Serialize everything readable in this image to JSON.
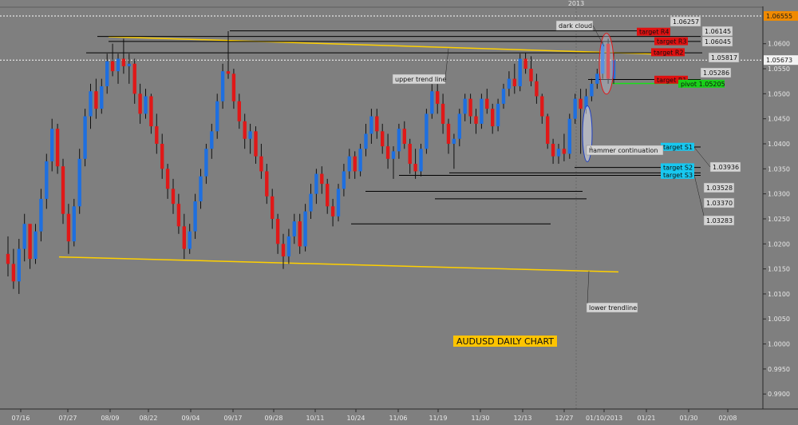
{
  "chart_data": {
    "type": "candlestick",
    "instrument": "AUDUSD",
    "title": "AUDUSD DAILY CHART",
    "period_marker": "2013",
    "x_tick_labels": [
      "07/16",
      "07/27",
      "08/09",
      "08/22",
      "09/04",
      "09/17",
      "09/28",
      "10/11",
      "10/24",
      "11/06",
      "11/19",
      "11/30",
      "12/13",
      "12/27",
      "01/10/2013",
      "01/21",
      "01/30",
      "02/08"
    ],
    "y_ticks": [
      "1.0600",
      "1.0550",
      "1.0500",
      "1.0450",
      "1.0400",
      "1.0350",
      "1.0300",
      "1.0250",
      "1.0200",
      "1.0150",
      "1.0100",
      "1.0050",
      "1.0000",
      "0.9950",
      "0.9900"
    ],
    "ylim": [
      0.987,
      1.0665
    ],
    "current_price": "1.05673",
    "high_price": "1.06555",
    "colors": {
      "up": "#1e6fe0",
      "down": "#e01818",
      "trend": "#ffd000",
      "bg": "#7f7f7f"
    },
    "candles": [
      [
        1.018,
        1.0215,
        1.0135,
        1.016
      ],
      [
        1.016,
        1.019,
        1.011,
        1.0125
      ],
      [
        1.0125,
        1.021,
        1.01,
        1.019
      ],
      [
        1.019,
        1.026,
        1.0165,
        1.024
      ],
      [
        1.024,
        1.0235,
        1.015,
        1.017
      ],
      [
        1.017,
        1.024,
        1.016,
        1.0225
      ],
      [
        1.0225,
        1.031,
        1.0205,
        1.029
      ],
      [
        1.029,
        1.038,
        1.027,
        1.0365
      ],
      [
        1.0365,
        1.045,
        1.0345,
        1.043
      ],
      [
        1.043,
        1.044,
        1.034,
        1.0355
      ],
      [
        1.0355,
        1.037,
        1.024,
        1.026
      ],
      [
        1.026,
        1.028,
        1.018,
        1.0205
      ],
      [
        1.0205,
        1.029,
        1.0195,
        1.0275
      ],
      [
        1.0275,
        1.039,
        1.026,
        1.037
      ],
      [
        1.037,
        1.047,
        1.0355,
        1.0455
      ],
      [
        1.0455,
        1.052,
        1.043,
        1.0505
      ],
      [
        1.0505,
        1.053,
        1.045,
        1.047
      ],
      [
        1.047,
        1.053,
        1.046,
        1.0515
      ],
      [
        1.0515,
        1.058,
        1.05,
        1.0565
      ],
      [
        1.0565,
        1.06,
        1.0535,
        1.0545
      ],
      [
        1.0545,
        1.058,
        1.052,
        1.057
      ],
      [
        1.057,
        1.061,
        1.054,
        1.0555
      ],
      [
        1.0555,
        1.058,
        1.052,
        1.056
      ],
      [
        1.056,
        1.057,
        1.048,
        1.05
      ],
      [
        1.05,
        1.052,
        1.044,
        1.046
      ],
      [
        1.046,
        1.051,
        1.045,
        1.0495
      ],
      [
        1.0495,
        1.05,
        1.042,
        1.0435
      ],
      [
        1.0435,
        1.046,
        1.038,
        1.04
      ],
      [
        1.04,
        1.042,
        1.033,
        1.035
      ],
      [
        1.035,
        1.036,
        1.029,
        1.031
      ],
      [
        1.031,
        1.033,
        1.026,
        1.028
      ],
      [
        1.028,
        1.03,
        1.022,
        1.0235
      ],
      [
        1.0235,
        1.026,
        1.017,
        1.019
      ],
      [
        1.019,
        1.024,
        1.018,
        1.0225
      ],
      [
        1.0225,
        1.03,
        1.021,
        1.0285
      ],
      [
        1.0285,
        1.035,
        1.027,
        1.0335
      ],
      [
        1.0335,
        1.04,
        1.032,
        1.039
      ],
      [
        1.039,
        1.044,
        1.037,
        1.0425
      ],
      [
        1.0425,
        1.05,
        1.041,
        1.0485
      ],
      [
        1.0485,
        1.056,
        1.047,
        1.0545
      ],
      [
        1.0545,
        1.0625,
        1.053,
        1.054
      ],
      [
        1.054,
        1.055,
        1.047,
        1.0485
      ],
      [
        1.0485,
        1.05,
        1.043,
        1.0445
      ],
      [
        1.0445,
        1.046,
        1.039,
        1.041
      ],
      [
        1.041,
        1.044,
        1.038,
        1.0425
      ],
      [
        1.0425,
        1.0435,
        1.036,
        1.0375
      ],
      [
        1.0375,
        1.04,
        1.033,
        1.0345
      ],
      [
        1.0345,
        1.036,
        1.028,
        1.0295
      ],
      [
        1.0295,
        1.031,
        1.023,
        1.025
      ],
      [
        1.025,
        1.026,
        1.018,
        1.02
      ],
      [
        1.02,
        1.022,
        1.015,
        1.0175
      ],
      [
        1.0175,
        1.023,
        1.016,
        1.0215
      ],
      [
        1.0215,
        1.026,
        1.02,
        1.0245
      ],
      [
        1.0245,
        1.026,
        1.018,
        1.0195
      ],
      [
        1.0195,
        1.028,
        1.0185,
        1.0265
      ],
      [
        1.0265,
        1.032,
        1.025,
        1.03
      ],
      [
        1.03,
        1.035,
        1.028,
        1.034
      ],
      [
        1.034,
        1.0355,
        1.03,
        1.032
      ],
      [
        1.032,
        1.033,
        1.026,
        1.0275
      ],
      [
        1.0275,
        1.029,
        1.0235,
        1.0255
      ],
      [
        1.0255,
        1.032,
        1.0245,
        1.031
      ],
      [
        1.031,
        1.036,
        1.0295,
        1.0345
      ],
      [
        1.0345,
        1.039,
        1.033,
        1.0375
      ],
      [
        1.0375,
        1.0385,
        1.033,
        1.0345
      ],
      [
        1.0345,
        1.04,
        1.0335,
        1.039
      ],
      [
        1.039,
        1.044,
        1.0375,
        1.042
      ],
      [
        1.042,
        1.047,
        1.04,
        1.0455
      ],
      [
        1.0455,
        1.047,
        1.041,
        1.0425
      ],
      [
        1.0425,
        1.044,
        1.038,
        1.0395
      ],
      [
        1.0395,
        1.042,
        1.035,
        1.037
      ],
      [
        1.037,
        1.0395,
        1.033,
        1.0385
      ],
      [
        1.0385,
        1.044,
        1.037,
        1.043
      ],
      [
        1.043,
        1.0445,
        1.039,
        1.04
      ],
      [
        1.04,
        1.041,
        1.034,
        1.036
      ],
      [
        1.036,
        1.039,
        1.033,
        1.0345
      ],
      [
        1.0345,
        1.04,
        1.0335,
        1.039
      ],
      [
        1.039,
        1.047,
        1.038,
        1.046
      ],
      [
        1.046,
        1.052,
        1.045,
        1.0505
      ],
      [
        1.0505,
        1.0525,
        1.046,
        1.048
      ],
      [
        1.048,
        1.05,
        1.042,
        1.044
      ],
      [
        1.044,
        1.045,
        1.038,
        1.04
      ],
      [
        1.04,
        1.042,
        1.035,
        1.041
      ],
      [
        1.041,
        1.047,
        1.0395,
        1.046
      ],
      [
        1.046,
        1.05,
        1.0445,
        1.049
      ],
      [
        1.049,
        1.05,
        1.044,
        1.0455
      ],
      [
        1.0455,
        1.047,
        1.042,
        1.044
      ],
      [
        1.044,
        1.05,
        1.043,
        1.049
      ],
      [
        1.049,
        1.051,
        1.046,
        1.047
      ],
      [
        1.047,
        1.048,
        1.042,
        1.0435
      ],
      [
        1.0435,
        1.049,
        1.0425,
        1.048
      ],
      [
        1.048,
        1.052,
        1.047,
        1.051
      ],
      [
        1.051,
        1.0545,
        1.0495,
        1.053
      ],
      [
        1.053,
        1.056,
        1.05,
        1.0515
      ],
      [
        1.0515,
        1.058,
        1.0505,
        1.057
      ],
      [
        1.057,
        1.0582,
        1.054,
        1.055
      ],
      [
        1.055,
        1.0575,
        1.0515,
        1.0525
      ],
      [
        1.0525,
        1.054,
        1.048,
        1.0495
      ],
      [
        1.0495,
        1.05,
        1.044,
        1.0455
      ],
      [
        1.0455,
        1.046,
        1.039,
        1.04
      ],
      [
        1.04,
        1.041,
        1.036,
        1.0375
      ],
      [
        1.0375,
        1.04,
        1.036,
        1.039
      ],
      [
        1.039,
        1.042,
        1.0365,
        1.038
      ],
      [
        1.038,
        1.046,
        1.037,
        1.045
      ],
      [
        1.045,
        1.05,
        1.044,
        1.049
      ],
      [
        1.049,
        1.051,
        1.038,
        1.047
      ],
      [
        1.047,
        1.051,
        1.046,
        1.0495
      ],
      [
        1.0495,
        1.053,
        1.0485,
        1.052
      ],
      [
        1.052,
        1.055,
        1.051,
        1.054
      ],
      [
        1.054,
        1.0605,
        1.053,
        1.06
      ],
      [
        1.06,
        1.061,
        1.052,
        1.053
      ],
      [
        1.053,
        1.058,
        1.052,
        1.0567
      ]
    ],
    "horizontal_levels": [
      {
        "price": 1.06257,
        "label": "1.06257"
      },
      {
        "price": 1.06145,
        "label": "1.06145"
      },
      {
        "price": 1.06045,
        "label": "1.06045"
      },
      {
        "price": 1.05817,
        "label": "1.05817"
      },
      {
        "price": 1.05286,
        "label": "1.05286"
      },
      {
        "price": 1.03936,
        "label": "1.03936"
      },
      {
        "price": 1.03528,
        "label": "1.03528"
      },
      {
        "price": 1.0337,
        "label": "1.03370"
      },
      {
        "price": 1.03283,
        "label": "1.03283"
      }
    ],
    "targets": [
      {
        "label": "target R4",
        "kind": "resistance"
      },
      {
        "label": "target R3",
        "kind": "resistance"
      },
      {
        "label": "target R2",
        "kind": "resistance"
      },
      {
        "label": "target R1",
        "kind": "resistance"
      },
      {
        "label": "pivot 1.05205",
        "kind": "pivot"
      },
      {
        "label": "target S1",
        "kind": "support"
      },
      {
        "label": "target S2",
        "kind": "support"
      },
      {
        "label": "target S3",
        "kind": "support"
      }
    ],
    "annotations": {
      "dark_cloud": "dark cloud",
      "upper_trend": "upper trend line",
      "hammer": "hammer continuation",
      "lower_trend": "lower trendline"
    }
  }
}
